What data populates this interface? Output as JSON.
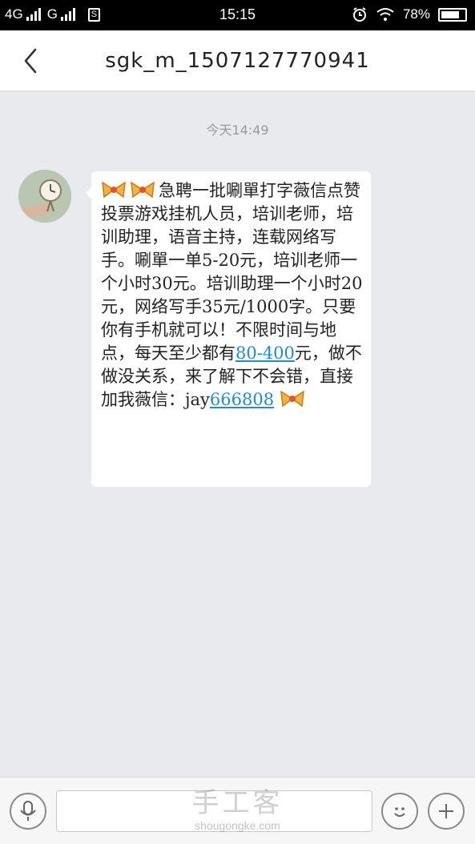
{
  "status_bar": {
    "network1": "4G",
    "network2": "G",
    "sim_label": "S",
    "time": "15:15",
    "battery_text": "78%",
    "battery_level": 0.78
  },
  "nav": {
    "title": "sgk_m_1507127770941"
  },
  "chat": {
    "timestamp": "今天14:49",
    "message": {
      "emoji_name": "bow-emoji",
      "text_main": "急聘一批唰單打字薇信点赞投票游戏挂机人员，培训老师，培训助理，语音主持，连载网络写手。唰單一单5-20元，培训老师一个小时30元。培训助理一个小时20元，网络写手35元/1000字。只要你有手机就可以！不限时间与地点，每天至少都有",
      "link1": "80-400",
      "text_after": "元，做不做没关系，来了解下不会错，直接加我薇信：jay",
      "link2": "666808"
    }
  },
  "input_bar": {
    "placeholder": "",
    "watermark": "手工客",
    "watermark_url": "shougongke.com"
  },
  "colors": {
    "link": "#1f8ad6",
    "background": "#e8eaee"
  }
}
